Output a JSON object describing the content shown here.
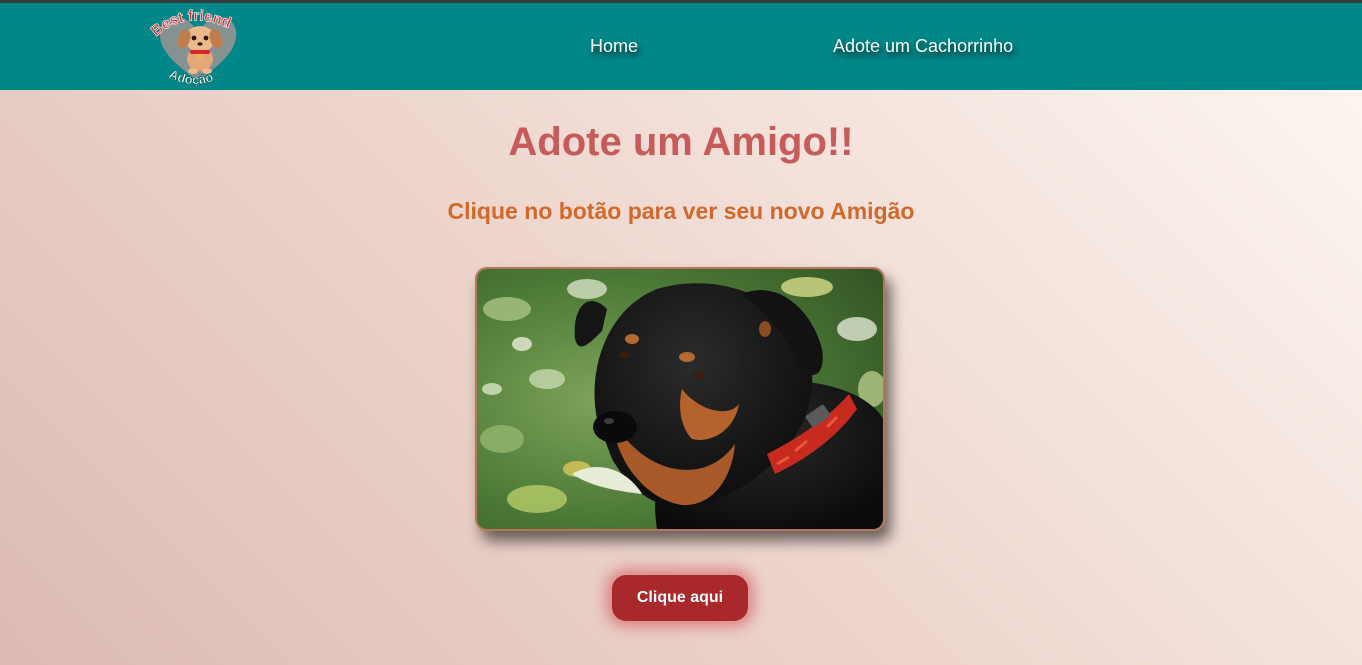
{
  "header": {
    "logo": {
      "top_text": "Best friend",
      "bottom_text": "Adoção",
      "icon": "puppy-heart-logo"
    },
    "nav": [
      {
        "label": "Home"
      },
      {
        "label": "Adote um Cachorrinho"
      }
    ],
    "colors": {
      "bar": "#008787",
      "link": "#ffffff"
    }
  },
  "main": {
    "title": "Adote um Amigo!!",
    "subtitle": "Clique no botão para ver seu novo Amigão",
    "image": {
      "alt": "Rottweiler dog photo",
      "icon": "dog-photo"
    },
    "button_label": "Clique aqui",
    "colors": {
      "title": "#c75a5a",
      "subtitle": "#d2692a",
      "button": "#a8282c"
    }
  }
}
